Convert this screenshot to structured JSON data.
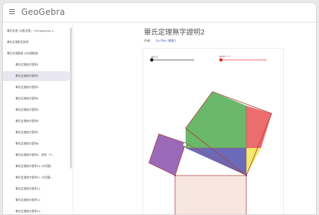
{
  "app": {
    "logo_text": "GeoGebra",
    "menu_icon": "hamburger-menu-icon"
  },
  "sidebar": {
    "items": [
      {
        "label": "畢氏定理 (勾股定理) - Pythagorean t...",
        "level": 0,
        "active": false
      },
      {
        "label": "畢氏定理影音說明",
        "level": 0,
        "active": false
      },
      {
        "label": "畢氏定理動畫 (共8個動畫)",
        "level": 0,
        "active": false
      },
      {
        "label": "畢氏定理無字證明1",
        "level": 1,
        "active": false
      },
      {
        "label": "畢氏定理無字證明2",
        "level": 1,
        "active": true
      },
      {
        "label": "畢氏定理無字證明3",
        "level": 1,
        "active": false
      },
      {
        "label": "畢氏定理無字證明4",
        "level": 1,
        "active": false
      },
      {
        "label": "畢氏定理無字證明5",
        "level": 1,
        "active": false
      },
      {
        "label": "畢氏定理無字證明6",
        "level": 1,
        "active": false
      },
      {
        "label": "畢氏定理無字證明7",
        "level": 1,
        "active": false
      },
      {
        "label": "畢氏定理無字證明8",
        "level": 1,
        "active": false
      },
      {
        "label": "畢氏定理無字證明9 - 帕特（Ｐ...",
        "level": 1,
        "active": false
      },
      {
        "label": "畢氏定理無字證明10 (內切圓)",
        "level": 1,
        "active": false
      },
      {
        "label": "畢氏定理無字證明11 (內切圓...",
        "level": 1,
        "active": false
      },
      {
        "label": "畢氏定理無字證明12",
        "level": 1,
        "active": false
      },
      {
        "label": "畢氏定理無字證明13",
        "level": 1,
        "active": false
      },
      {
        "label": "畢氏定理無字證明14",
        "level": 1,
        "active": false
      }
    ]
  },
  "main": {
    "title": "畢氏定理無字證明2",
    "author_label": "作者：",
    "author_name": "Liu Ruo (劉若)"
  },
  "applet": {
    "slider1_label": "大小 a",
    "slider1_value": 0.5,
    "slider2_label": "speed = 1",
    "slider2_value": 0,
    "colors": {
      "green": "#6ab86a",
      "red": "#ec6d6d",
      "yellow": "#f2ea6a",
      "blue": "#6a6ab8",
      "purple": "#9a6ab8",
      "peach": "#f6e6de",
      "outline": "#b04040",
      "slider_black": "#222222",
      "slider_red": "#e03030"
    }
  }
}
